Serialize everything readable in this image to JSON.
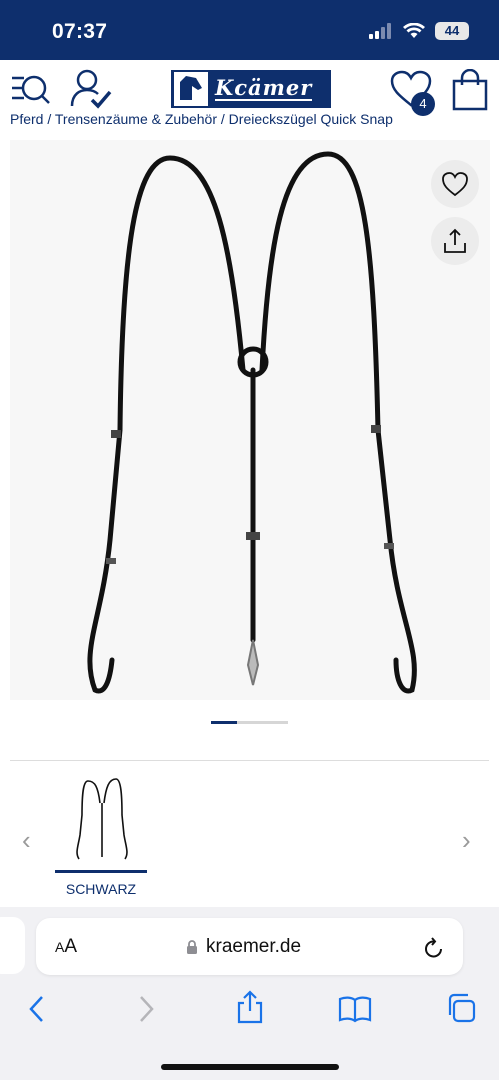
{
  "status": {
    "time": "07:37",
    "battery": "44"
  },
  "header": {
    "logo_text": "Kcämer",
    "wishlist_count": "4"
  },
  "breadcrumb": "Pferd / Trensenzäume & Zubehör / Dreieckszügel Quick Snap",
  "variants": [
    {
      "label": "SCHWARZ",
      "selected": true
    }
  ],
  "browser": {
    "text_size_label_small": "A",
    "text_size_label_large": "A",
    "url": "kraemer.de"
  },
  "icons": {
    "search_menu": "search-menu-icon",
    "account": "account-check-icon",
    "wishlist": "heart-icon",
    "cart": "shopping-bag-icon",
    "favorite": "heart-outline-icon",
    "share": "share-icon",
    "prev": "chevron-left-icon",
    "next": "chevron-right-icon",
    "lock": "lock-icon",
    "reload": "reload-icon",
    "back": "back-arrow-icon",
    "forward": "forward-arrow-icon",
    "bookmarks": "book-icon",
    "tabs": "tabs-icon"
  },
  "colors": {
    "brand": "#0e2f6d",
    "status_bar": "#0e2f6d",
    "toolbar_accent": "#1a73e8"
  }
}
